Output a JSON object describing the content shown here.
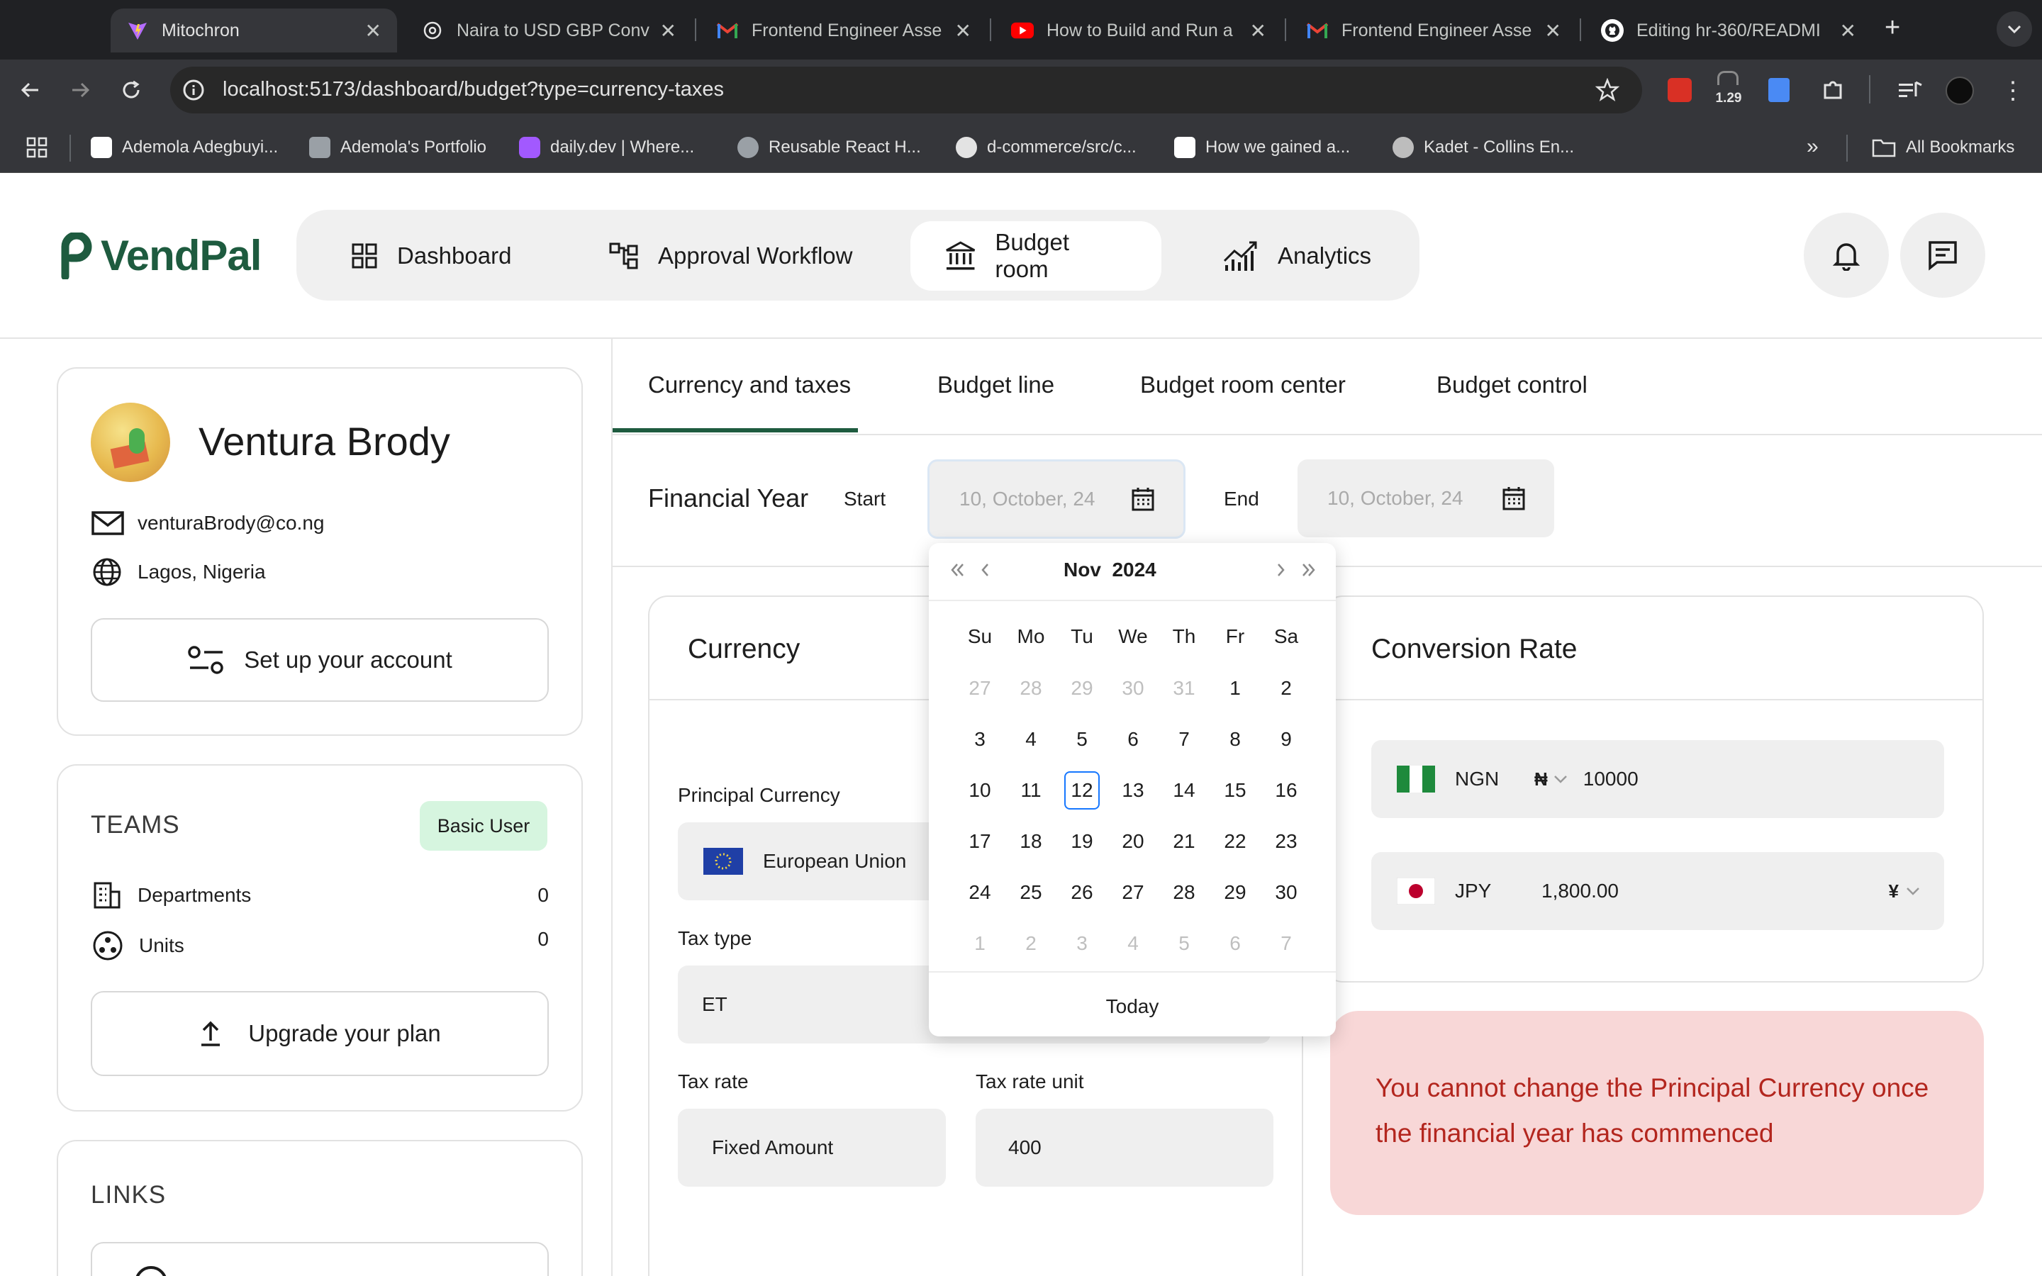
{
  "browser": {
    "tabs": [
      {
        "title": "Mitochron",
        "icon": "vite-icon",
        "active": true
      },
      {
        "title": "Naira to USD GBP Conve",
        "icon": "openai-icon"
      },
      {
        "title": "Frontend Engineer Asse",
        "icon": "gmail-icon"
      },
      {
        "title": "How to Build and Run a",
        "icon": "youtube-icon"
      },
      {
        "title": "Frontend Engineer Asse",
        "icon": "gmail-icon"
      },
      {
        "title": "Editing hr-360/READMI",
        "icon": "github-icon"
      }
    ],
    "url": "localhost:5173/dashboard/budget?type=currency-taxes",
    "extension_badge": "1.29",
    "bookmarks": [
      "Ademola Adegbuyi...",
      "Ademola's Portfolio",
      "daily.dev | Where...",
      "Reusable React H...",
      "d-commerce/src/c...",
      "How we gained a...",
      "Kadet - Collins En..."
    ],
    "all_bookmarks": "All Bookmarks"
  },
  "app": {
    "logo": "VendPal",
    "nav": [
      {
        "label": "Dashboard",
        "icon": "grid-icon"
      },
      {
        "label": "Approval Workflow",
        "icon": "workflow-icon"
      },
      {
        "label": "Budget room",
        "icon": "bank-icon",
        "active": true
      },
      {
        "label": "Analytics",
        "icon": "chart-icon"
      }
    ]
  },
  "profile": {
    "name": "Ventura Brody",
    "email": "venturaBrody@co.ng",
    "location": "Lagos, Nigeria",
    "setup_button": "Set up your account"
  },
  "teams": {
    "title": "TEAMS",
    "badge": "Basic User",
    "departments_label": "Departments",
    "departments_count": "0",
    "units_label": "Units",
    "units_count": "0",
    "upgrade_button": "Upgrade your plan"
  },
  "links": {
    "title": "LINKS"
  },
  "subtabs": [
    "Currency and taxes",
    "Budget line",
    "Budget room center",
    "Budget control"
  ],
  "financial_year": {
    "title": "Financial Year",
    "start_label": "Start",
    "start_placeholder": "10, October, 24",
    "end_label": "End",
    "end_placeholder": "10, October, 24"
  },
  "calendar": {
    "month": "Nov",
    "year": "2024",
    "weekdays": [
      "Su",
      "Mo",
      "Tu",
      "We",
      "Th",
      "Fr",
      "Sa"
    ],
    "weeks": [
      [
        "27",
        "28",
        "29",
        "30",
        "31",
        "1",
        "2"
      ],
      [
        "3",
        "4",
        "5",
        "6",
        "7",
        "8",
        "9"
      ],
      [
        "10",
        "11",
        "12",
        "13",
        "14",
        "15",
        "16"
      ],
      [
        "17",
        "18",
        "19",
        "20",
        "21",
        "22",
        "23"
      ],
      [
        "24",
        "25",
        "26",
        "27",
        "28",
        "29",
        "30"
      ],
      [
        "1",
        "2",
        "3",
        "4",
        "5",
        "6",
        "7"
      ]
    ],
    "today_label": "Today",
    "today_value": "12"
  },
  "currency": {
    "title": "Currency",
    "principal_label": "Principal Currency",
    "principal_value": "European Union",
    "tax_type_label": "Tax type",
    "tax_type_value": "ET",
    "tax_rate_label": "Tax rate",
    "tax_rate_value": "Fixed Amount",
    "tax_rate_unit_label": "Tax rate unit",
    "tax_rate_unit_value": "400"
  },
  "conversion": {
    "title": "Conversion Rate",
    "row1": {
      "code": "NGN",
      "symbol": "₦",
      "value": "10000"
    },
    "row2": {
      "code": "JPY",
      "value": "1,800.00",
      "symbol": "¥"
    }
  },
  "alert": {
    "line1": "You cannot change the Principal Currency once",
    "line2": "the financial year has commenced"
  },
  "colors": {
    "brand": "#1e5b3f",
    "alert_bg": "#f8d7d7",
    "alert_text": "#b3261e",
    "badge_bg": "#d6f5df",
    "tab_underline": "#1e5b3f"
  }
}
